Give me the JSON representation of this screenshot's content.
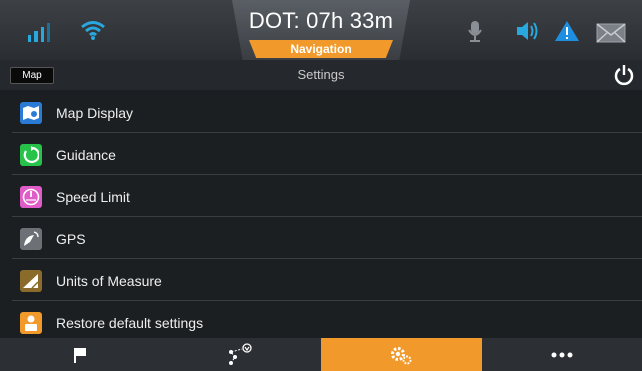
{
  "statusbar": {
    "dot_text": "DOT: 07h 33m",
    "nav_tab": "Navigation",
    "icons": [
      "signal-icon",
      "wifi-icon",
      "microphone-icon",
      "speaker-icon",
      "warning-icon",
      "mail-icon"
    ]
  },
  "titlebar": {
    "map_button": "Map",
    "title": "Settings",
    "power_icon": "power-icon"
  },
  "menu": {
    "items": [
      {
        "label": "Map Display",
        "icon": "map-display-icon",
        "color": "#2a7bd6"
      },
      {
        "label": "Guidance",
        "icon": "guidance-icon",
        "color": "#27c24a"
      },
      {
        "label": "Speed Limit",
        "icon": "speed-limit-icon",
        "color": "#e05cc8"
      },
      {
        "label": "GPS",
        "icon": "gps-icon",
        "color": "#6d7075"
      },
      {
        "label": "Units of Measure",
        "icon": "units-icon",
        "color": "#8a6b2c"
      },
      {
        "label": "Restore default settings",
        "icon": "restore-icon",
        "color": "#f19a2b"
      }
    ]
  },
  "bottombar": {
    "buttons": [
      {
        "name": "flag-icon",
        "active": false
      },
      {
        "name": "route-icon",
        "active": false
      },
      {
        "name": "settings-icon",
        "active": true
      },
      {
        "name": "more-icon",
        "active": false
      }
    ],
    "accent": "#f19a2b"
  }
}
